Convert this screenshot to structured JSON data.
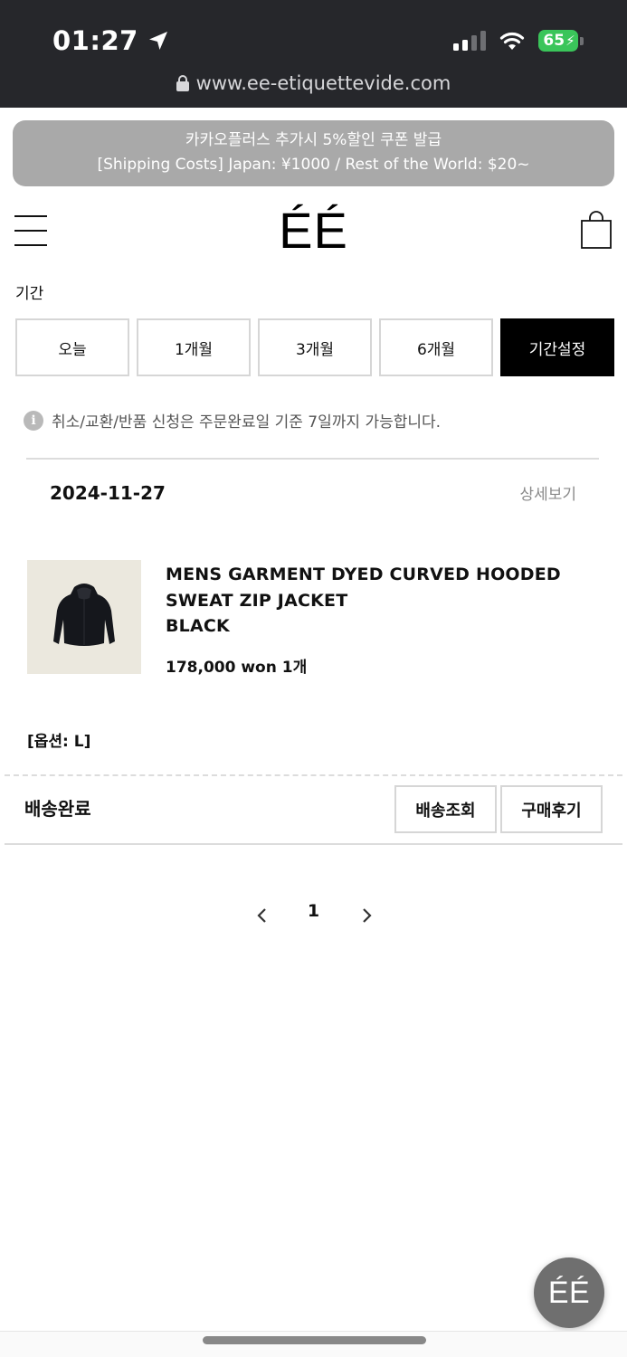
{
  "status_bar": {
    "time": "01:27",
    "battery": "65",
    "url": "www.ee-etiquettevide.com"
  },
  "promo": {
    "line1": "카카오플러스 추가시 5%할인 쿠폰 발급",
    "line2": "[Shipping Costs] Japan: ¥1000 / Rest of the World: $20~"
  },
  "header": {
    "logo": "ÉÉ"
  },
  "period": {
    "label": "기간",
    "options": [
      "오늘",
      "1개월",
      "3개월",
      "6개월",
      "기간설정"
    ],
    "active": "기간설정"
  },
  "notice": "취소/교환/반품 신청은 주문완료일 기준 7일까지 가능합니다.",
  "order": {
    "date": "2024-11-27",
    "detail_label": "상세보기",
    "product": {
      "name_line1": "MENS GARMENT DYED CURVED HOODED",
      "name_line2": "SWEAT ZIP JACKET",
      "color": "BLACK",
      "price": "178,000 won 1개",
      "option": "[옵션: L]"
    },
    "status": "배송완료",
    "actions": {
      "tracking": "배송조회",
      "review": "구매후기"
    }
  },
  "pagination": {
    "current": "1"
  },
  "fab": {
    "label": "ÉÉ"
  },
  "colors": {
    "status_bar_bg": "#26272b",
    "promo_bg": "#a9a9a9",
    "active_button_bg": "#000000",
    "battery_green": "#3ac55a"
  }
}
